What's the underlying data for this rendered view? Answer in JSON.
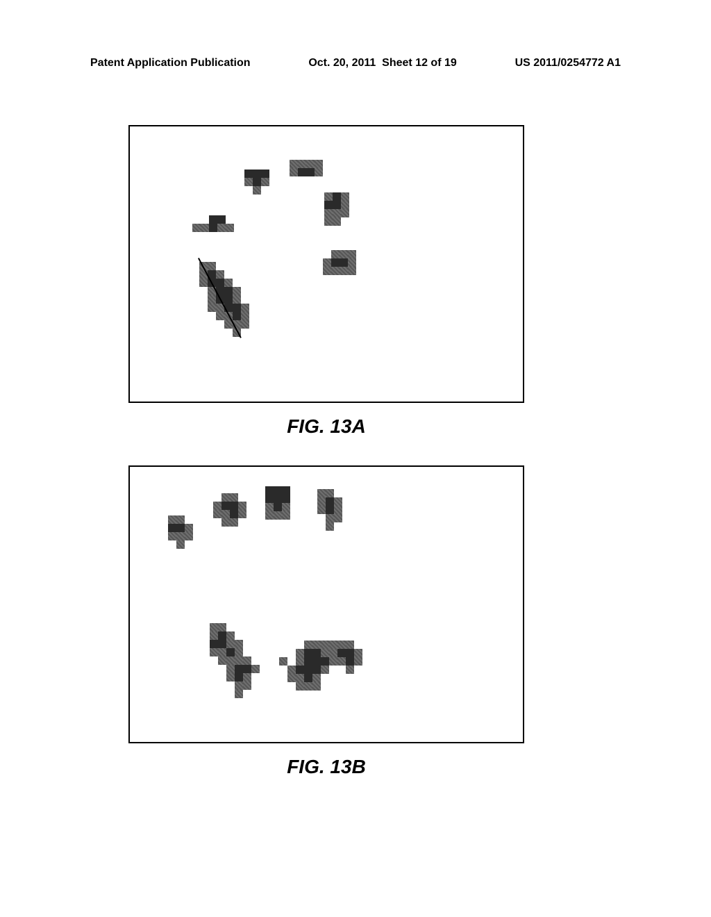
{
  "header": {
    "left": "Patent Application Publication",
    "date": "Oct. 20, 2011",
    "sheet": "Sheet 12 of 19",
    "pubnum": "US 2011/0254772 A1"
  },
  "figures": {
    "a": {
      "label": "FIG. 13A"
    },
    "b": {
      "label": "FIG. 13B"
    }
  }
}
